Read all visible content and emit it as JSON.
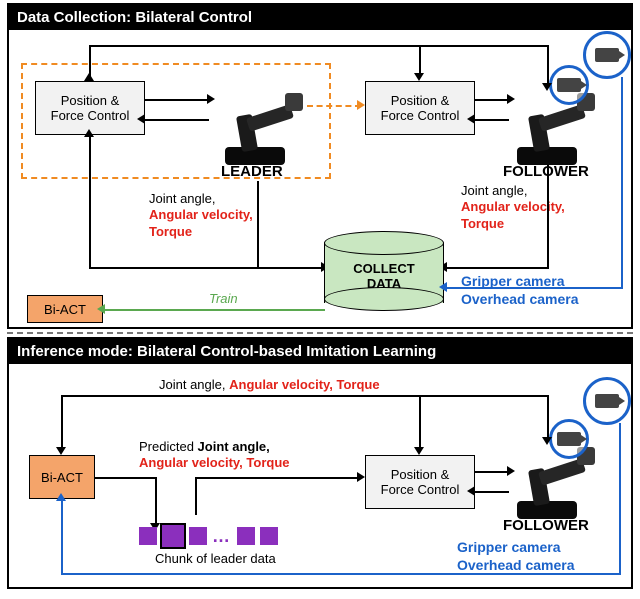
{
  "top": {
    "title": "Data Collection: Bilateral Control",
    "pfc1": "Position &\nForce Control",
    "pfc2": "Position &\nForce Control",
    "leader": "LEADER",
    "follower": "FOLLOWER",
    "signal1_line1": "Joint angle,",
    "signal1_line2": "Angular velocity,",
    "signal1_line3": "Torque",
    "signal2_line1": "Joint angle,",
    "signal2_line2": "Angular velocity,",
    "signal2_line3": "Torque",
    "collect": "COLLECT\nDATA",
    "biact": "Bi-ACT",
    "train": "Train",
    "cam1": "Gripper camera",
    "cam2": "Overhead camera"
  },
  "bot": {
    "title": "Inference mode: Bilateral Control-based Imitation Learning",
    "biact": "Bi-ACT",
    "pfc": "Position &\nForce Control",
    "follower": "FOLLOWER",
    "feedback_a": "Joint angle, ",
    "feedback_b": "Angular velocity, Torque",
    "pred_a": "Predicted ",
    "pred_b": "Joint angle,",
    "pred_c": "Angular velocity, Torque",
    "chunk": "Chunk of leader data",
    "cam1": "Gripper camera",
    "cam2": "Overhead camera"
  }
}
